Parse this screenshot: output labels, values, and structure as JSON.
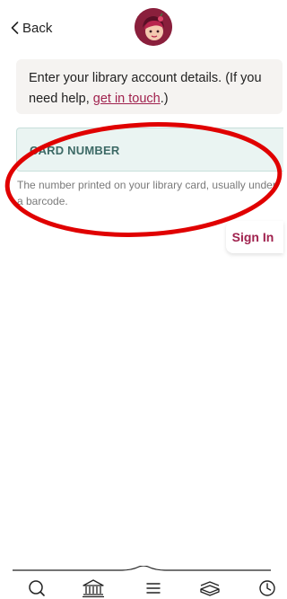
{
  "header": {
    "back_label": "Back"
  },
  "info": {
    "text_before": "Enter your library account details. (If you need help, ",
    "link_text": "get in touch",
    "text_after": ".)"
  },
  "form": {
    "card_number_label": "CARD NUMBER",
    "card_number_hint": "The number printed on your library card, usually under a barcode.",
    "sign_in_label": "Sign In"
  },
  "tabs": [
    {
      "icon": "search-icon"
    },
    {
      "icon": "library-icon"
    },
    {
      "icon": "menu-icon"
    },
    {
      "icon": "bookshelf-icon"
    },
    {
      "icon": "clock-icon"
    }
  ],
  "colors": {
    "accent": "#a0224e",
    "logo_bg": "#8a1f3c",
    "field_bg": "#eaf4f2",
    "field_text": "#3d6a66",
    "annotation": "#e00000"
  }
}
